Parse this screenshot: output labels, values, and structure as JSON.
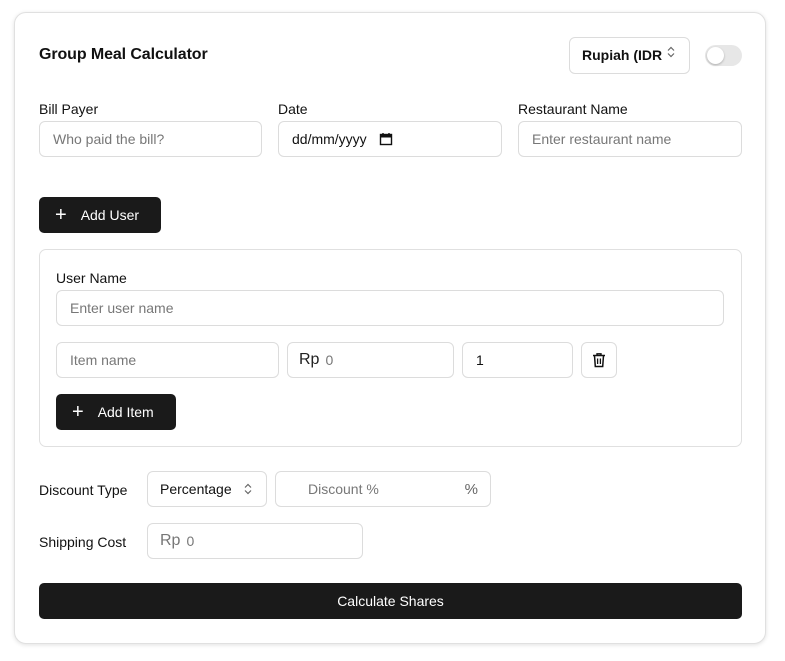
{
  "header": {
    "title": "Group Meal Calculator",
    "currency_selected": "Rupiah (IDR)",
    "dark_mode_toggle": "off"
  },
  "bill": {
    "payer_label": "Bill Payer",
    "payer_placeholder": "Who paid the bill?",
    "date_label": "Date",
    "date_placeholder": "dd/mm/yyyy",
    "restaurant_label": "Restaurant Name",
    "restaurant_placeholder": "Enter restaurant name"
  },
  "add_user_label": "Add User",
  "user": {
    "name_label": "User Name",
    "name_placeholder": "Enter user name",
    "item_name_placeholder": "Item name",
    "price_prefix": "Rp",
    "price_placeholder": "0",
    "quantity_value": "1",
    "add_item_label": "Add Item"
  },
  "discount": {
    "label": "Discount Type",
    "type_selected": "Percentage",
    "value_placeholder": "Discount %",
    "suffix": "%"
  },
  "shipping": {
    "label": "Shipping Cost",
    "prefix": "Rp",
    "placeholder": "0"
  },
  "calculate_label": "Calculate Shares",
  "colors": {
    "button_bg": "#1a1a1a",
    "border": "#dcdcdc",
    "placeholder": "#777777"
  }
}
